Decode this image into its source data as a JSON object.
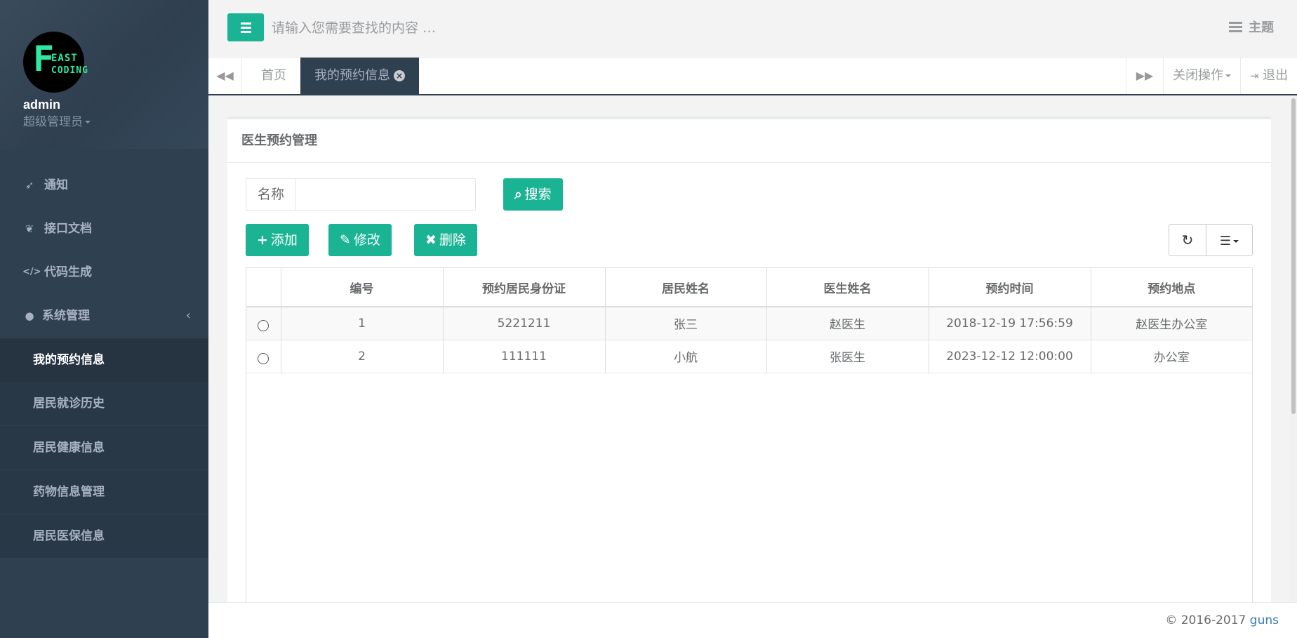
{
  "app": {
    "theme_color": "#1ab394",
    "sidebar_color": "#2f4050"
  },
  "profile": {
    "logo_big": "F",
    "logo_line1": "EAST",
    "logo_line2": "CODING",
    "name": "admin",
    "role": "超级管理员"
  },
  "sidebar": {
    "items": [
      {
        "label": "通知",
        "icon": "rocket-icon"
      },
      {
        "label": "接口文档",
        "icon": "leaf-icon"
      },
      {
        "label": "代码生成",
        "icon": "code-icon"
      },
      {
        "label": "系统管理",
        "icon": "user-icon",
        "expanded": true
      }
    ],
    "subitems": [
      {
        "label": "我的预约信息",
        "active": true
      },
      {
        "label": "居民就诊历史"
      },
      {
        "label": "居民健康信息"
      },
      {
        "label": "药物信息管理"
      },
      {
        "label": "居民医保信息"
      }
    ]
  },
  "topbar": {
    "search_placeholder": "请输入您需要查找的内容 …",
    "theme_label": "主题"
  },
  "tabs": {
    "home": "首页",
    "active": "我的预约信息",
    "close_ops": "关闭操作",
    "logout": "退出"
  },
  "panel": {
    "title": "医生预约管理",
    "filter_label": "名称",
    "filter_value": "",
    "search_btn": "搜索",
    "add_btn": "添加",
    "edit_btn": "修改",
    "delete_btn": "删除"
  },
  "table": {
    "columns": [
      "编号",
      "预约居民身份证",
      "居民姓名",
      "医生姓名",
      "预约时间",
      "预约地点"
    ],
    "rows": [
      [
        "1",
        "5221211",
        "张三",
        "赵医生",
        "2018-12-19 17:56:59",
        "赵医生办公室"
      ],
      [
        "2",
        "111111",
        "小航",
        "张医生",
        "2023-12-12 12:00:00",
        "办公室"
      ]
    ]
  },
  "footer": {
    "copyright": "© 2016-2017 ",
    "link": "guns"
  }
}
